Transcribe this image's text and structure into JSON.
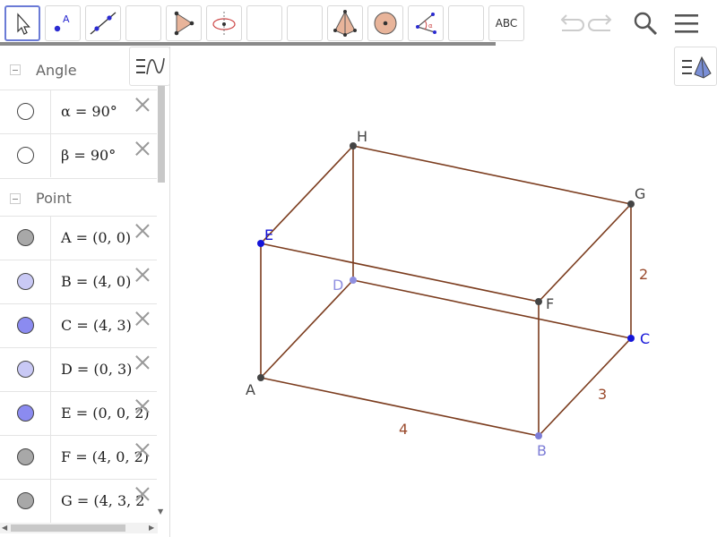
{
  "toolbar": {
    "tools": [
      {
        "id": "move",
        "icon": "move-arrow-icon"
      },
      {
        "id": "point",
        "icon": "point-icon"
      },
      {
        "id": "line",
        "icon": "line-icon"
      },
      {
        "id": "empty1",
        "icon": "blank-icon"
      },
      {
        "id": "pyramid",
        "icon": "pyramid-icon"
      },
      {
        "id": "rotate",
        "icon": "rotate-view-icon"
      },
      {
        "id": "empty2",
        "icon": "blank-icon"
      },
      {
        "id": "empty3",
        "icon": "blank-icon"
      },
      {
        "id": "tetra",
        "icon": "tetrahedron-icon"
      },
      {
        "id": "sphere",
        "icon": "sphere-icon"
      },
      {
        "id": "angle",
        "icon": "angle-icon"
      },
      {
        "id": "empty4",
        "icon": "blank-icon"
      },
      {
        "id": "text",
        "icon": "text-icon",
        "label": "ABC"
      }
    ],
    "colors": {
      "active_border": "#6b7bd6"
    }
  },
  "algebra": {
    "groups": [
      {
        "label": "Angle",
        "items": [
          {
            "text": "α = 90°",
            "marker_color": "#ffffff"
          },
          {
            "text": "β = 90°",
            "marker_color": "#ffffff"
          }
        ]
      },
      {
        "label": "Point",
        "items": [
          {
            "text": "A = (0, 0)",
            "marker_color": "#a8a8a8"
          },
          {
            "text": "B = (4, 0)",
            "marker_color": "#c9c9f5"
          },
          {
            "text": "C = (4, 3)",
            "marker_color": "#8b8bf0"
          },
          {
            "text": "D = (0, 3)",
            "marker_color": "#c9c9f5"
          },
          {
            "text": "E = (0, 0, 2)",
            "marker_color": "#8b8bf0"
          },
          {
            "text": "F = (4, 0, 2)",
            "marker_color": "#a8a8a8"
          },
          {
            "text": "G = (4, 3, 2",
            "marker_color": "#a8a8a8"
          }
        ]
      }
    ]
  },
  "graphics": {
    "points": {
      "A": {
        "label": "A",
        "color": "#444444"
      },
      "B": {
        "label": "B",
        "color": "#7c7cd6"
      },
      "C": {
        "label": "C",
        "color": "#1414d8"
      },
      "D": {
        "label": "D",
        "color": "#8f8fe0"
      },
      "E": {
        "label": "E",
        "color": "#1414d8"
      },
      "F": {
        "label": "F",
        "color": "#444444"
      },
      "G": {
        "label": "G",
        "color": "#444444"
      },
      "H": {
        "label": "H",
        "color": "#444444"
      }
    },
    "edge_labels": {
      "ab": "4",
      "bc": "3",
      "cg": "2"
    },
    "colors": {
      "edge": "#7b3c1e",
      "edge_label": "#9a4a2c"
    }
  }
}
